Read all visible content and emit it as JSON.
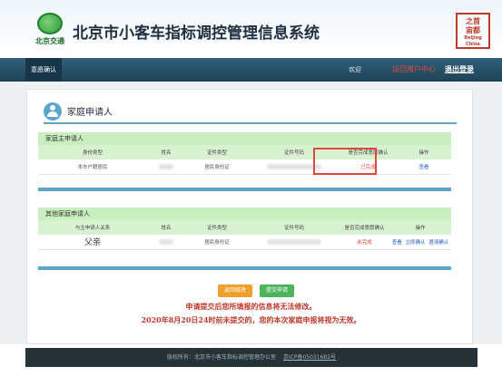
{
  "header": {
    "logo_text": "北京交通",
    "title": "北京市小客车指标调控管理信息系统",
    "seal_main": "之首\n宙都",
    "seal_sub": "Beijing China"
  },
  "nav": {
    "active_tab": "意愿确认",
    "welcome": "欢迎",
    "user_center": "返回用户中心",
    "logout": "退出登录"
  },
  "section": {
    "title": "家庭申请人"
  },
  "main_applicant": {
    "title": "家庭主申请人",
    "columns": [
      "身份类型",
      "姓名",
      "证件类型",
      "证件号码",
      "是否完成意愿确认",
      "操作"
    ],
    "rows": [
      {
        "identity": "本市户籍居民",
        "doc_type": "居民身份证",
        "status": "已完成",
        "action": "查看"
      }
    ]
  },
  "other_applicants": {
    "title": "其他家庭申请人",
    "columns": [
      "与主申请人关系",
      "姓名",
      "证件类型",
      "证件号码",
      "是否完成意愿确认",
      "操作"
    ],
    "rows": [
      {
        "relation": "父亲",
        "doc_type": "居民身份证",
        "status": "未完成",
        "action_view": "查看",
        "action_confirm": "立即确认",
        "action_invite": "邀请确认"
      }
    ]
  },
  "buttons": {
    "back": "返回修改",
    "submit": "提交申请"
  },
  "notice": {
    "line1": "申请提交后您所填报的信息将无法修改。",
    "line2": "2020年8月20日24时前未提交的，您的本次家庭申报将视为无效。"
  },
  "footer": {
    "copyright": "版权所有：北京市小客车指标调控管理办公室",
    "icp": "京ICP备05031682号"
  },
  "colors": {
    "accent": "#5aa7c9",
    "warning": "#e0473a",
    "nav": "#1e4357",
    "table_header": "#c9eec0"
  }
}
